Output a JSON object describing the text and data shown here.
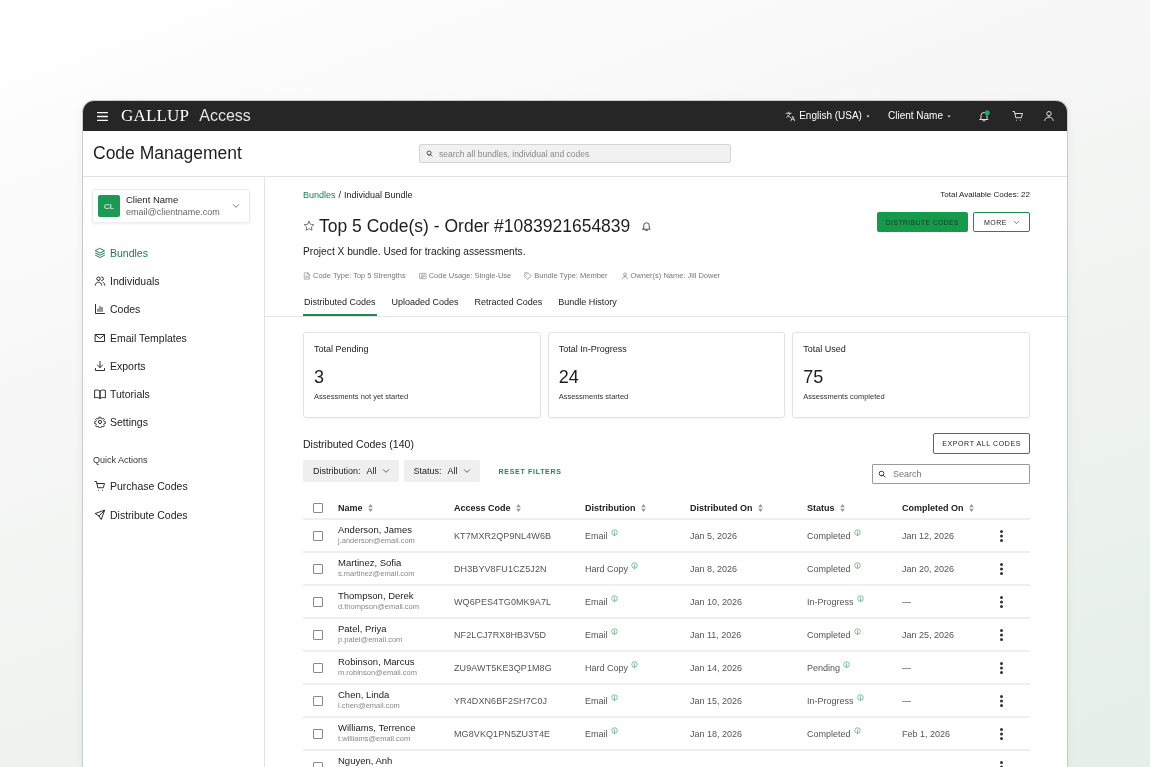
{
  "top_bar": {
    "brand": "GALLUP",
    "product": "Access",
    "language": "English (USA)",
    "account": "Client Name",
    "notifications_unread": true
  },
  "header": {
    "title": "Code Management",
    "search": {
      "placeholder": "search all bundles, individual and codes"
    }
  },
  "sidebar": {
    "client": {
      "initials": "CL",
      "name": "Client Name",
      "email": "email@clientname.com"
    },
    "items": [
      {
        "label": "Bundles",
        "selected": true
      },
      {
        "label": "Individuals",
        "selected": false
      },
      {
        "label": "Codes",
        "selected": false
      },
      {
        "label": "Email Templates",
        "selected": false
      },
      {
        "label": "Exports",
        "selected": false
      },
      {
        "label": "Tutorials",
        "selected": false
      },
      {
        "label": "Settings",
        "selected": false
      }
    ],
    "quick_actions": {
      "title": "Quick Actions",
      "items": [
        {
          "label": "Purchase Codes"
        },
        {
          "label": "Distribute Codes"
        }
      ]
    }
  },
  "breadcrumb": {
    "items": [
      {
        "label": "Bundles",
        "current": false
      },
      {
        "label": "Individual Bundle",
        "current": true
      }
    ],
    "separator": "/"
  },
  "total_available": "Total Available Codes: 22",
  "bundle": {
    "title": "Top 5 Code(s) - Order #1083921654839",
    "starred": false,
    "description": "Project X bundle. Used for tracking assessments.",
    "meta": [
      "Code Type: Top 5 Strengths",
      "Code Usage: Single-Use",
      "Bundle Type: Member",
      "Owner(s) Name: Jill Dower"
    ]
  },
  "actions": [
    {
      "label": "DISTRIBUTE CODES",
      "kind": "primary"
    },
    {
      "label": "MORE",
      "kind": "menu"
    }
  ],
  "tabs": [
    {
      "label": "Distributed Codes",
      "selected": true
    },
    {
      "label": "Uploaded Codes",
      "selected": false
    },
    {
      "label": "Retracted Codes",
      "selected": false
    },
    {
      "label": "Bundle History",
      "selected": false
    }
  ],
  "summary_cards": [
    {
      "title": "Total Pending",
      "value": "3",
      "caption": "Assessments not yet started"
    },
    {
      "title": "Total In-Progress",
      "value": "24",
      "caption": "Assessments started"
    },
    {
      "title": "Total Used",
      "value": "75",
      "caption": "Assessments completed"
    }
  ],
  "codes_list": {
    "title": "Distributed Codes (140)",
    "export_button": "EXPORT ALL CODES",
    "filters": [
      {
        "label": "Distribution:",
        "value": "All"
      },
      {
        "label": "Status:",
        "value": "All"
      }
    ],
    "reset_filters": "RESET FILTERS",
    "search": {
      "placeholder": "Search"
    }
  },
  "table": {
    "all_checked": false,
    "columns": [
      "Name",
      "Access Code",
      "Distribution",
      "Distributed On",
      "Status",
      "Completed On"
    ],
    "rows": [
      {
        "checked": false,
        "name": "Anderson, James",
        "email": "j.anderson@email.com",
        "access_code": "KT7MXR2QP9NL4W6B",
        "distribution": "Email",
        "distributed_on": "Jan 5, 2026",
        "status": "Completed",
        "completed_on": "Jan 12, 2026"
      },
      {
        "checked": false,
        "name": "Martinez, Sofia",
        "email": "s.martinez@email.com",
        "access_code": "DH3BYV8FU1CZ5J2N",
        "distribution": "Hard Copy",
        "distributed_on": "Jan 8, 2026",
        "status": "Completed",
        "completed_on": "Jan 20, 2026"
      },
      {
        "checked": false,
        "name": "Thompson, Derek",
        "email": "d.thompson@email.com",
        "access_code": "WQ6PES4TG0MK9A7L",
        "distribution": "Email",
        "distributed_on": "Jan 10, 2026",
        "status": "In-Progress",
        "completed_on": "—"
      },
      {
        "checked": false,
        "name": "Patel, Priya",
        "email": "p.patel@email.com",
        "access_code": "NF2LCJ7RX8HB3V5D",
        "distribution": "Email",
        "distributed_on": "Jan 11, 2026",
        "status": "Completed",
        "completed_on": "Jan 25, 2026"
      },
      {
        "checked": false,
        "name": "Robinson, Marcus",
        "email": "m.robinson@email.com",
        "access_code": "ZU9AWT5KE3QP1M8G",
        "distribution": "Hard Copy",
        "distributed_on": "Jan 14, 2026",
        "status": "Pending",
        "completed_on": "—"
      },
      {
        "checked": false,
        "name": "Chen, Linda",
        "email": "l.chen@email.com",
        "access_code": "YR4DXN6BF2SH7C0J",
        "distribution": "Email",
        "distributed_on": "Jan 15, 2026",
        "status": "In-Progress",
        "completed_on": "—"
      },
      {
        "checked": false,
        "name": "Williams, Terrence",
        "email": "t.williams@email.com",
        "access_code": "MG8VKQ1PN5ZU3T4E",
        "distribution": "Email",
        "distributed_on": "Jan 18, 2026",
        "status": "Completed",
        "completed_on": "Feb 1, 2026"
      },
      {
        "checked": false,
        "name": "Nguyen, Anh"
      }
    ]
  }
}
